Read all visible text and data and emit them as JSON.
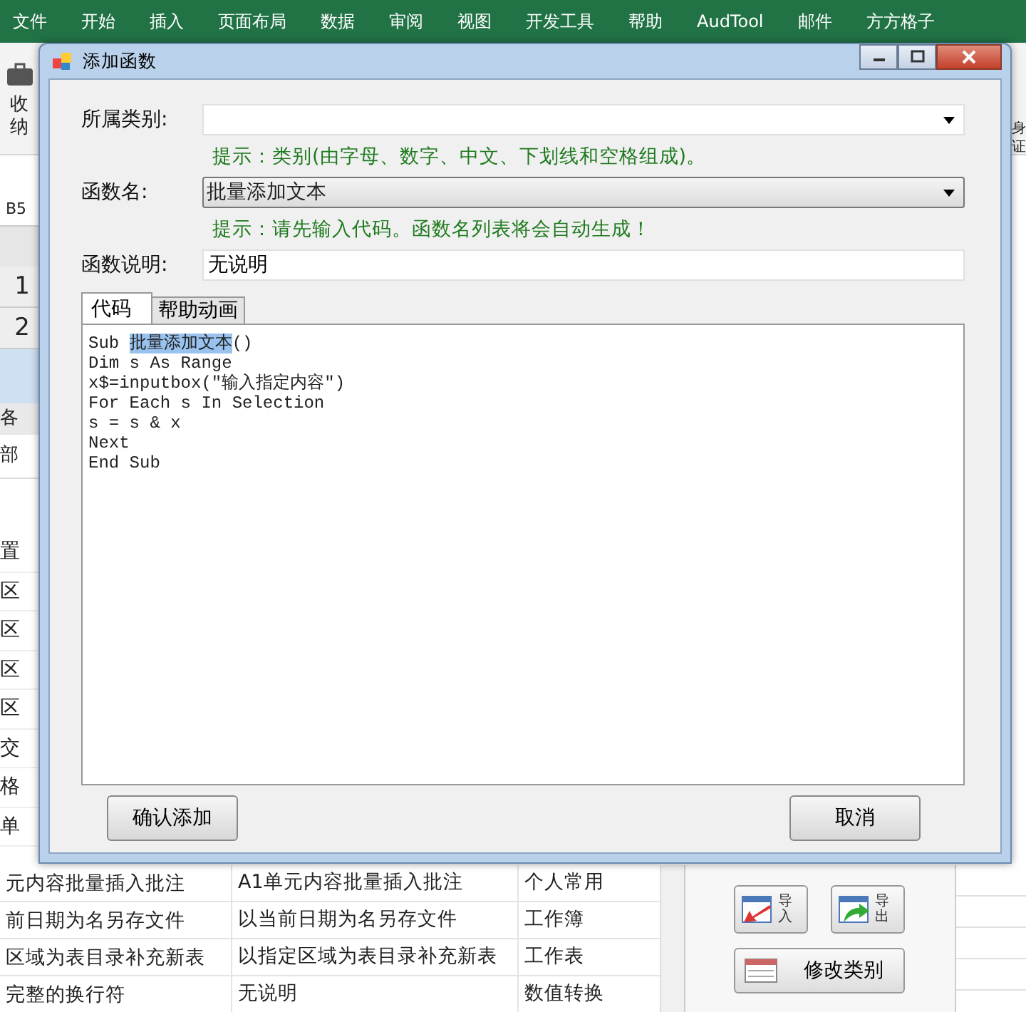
{
  "ribbon_tabs": [
    "文件",
    "开始",
    "插入",
    "页面布局",
    "数据",
    "审阅",
    "视图",
    "开发工具",
    "帮助",
    "AudTool",
    "邮件",
    "方方格子"
  ],
  "ribbon_left_labels": [
    "收",
    "纳"
  ],
  "ribbon_right_labels": [
    "身",
    "证"
  ],
  "name_box": "B5",
  "row_headers": [
    "1",
    "2"
  ],
  "side_list": {
    "header": "各",
    "first": "部",
    "items": [
      "置",
      "区",
      "区",
      "区",
      "区",
      "交",
      "格",
      "单"
    ]
  },
  "dialog": {
    "title": "添加函数",
    "category": {
      "label": "所属类别:",
      "hint": "提示：类别(由字母、数字、中文、下划线和空格组成)。"
    },
    "function_name": {
      "label": "函数名:",
      "value": "批量添加文本",
      "hint": "提示：请先输入代码。函数名列表将会自动生成！"
    },
    "description": {
      "label": "函数说明:",
      "value": "无说明"
    },
    "tabs": [
      {
        "label": "代码",
        "selected": true
      },
      {
        "label": "帮助动画",
        "selected": false
      }
    ],
    "code_lines": [
      {
        "segments": [
          {
            "text": "Sub ",
            "selected": false
          },
          {
            "text": "批量添加文本",
            "selected": true
          },
          {
            "text": "()",
            "selected": false
          }
        ]
      },
      {
        "segments": [
          {
            "text": "Dim s As Range",
            "selected": false
          }
        ]
      },
      {
        "segments": [
          {
            "text": "x$=inputbox(\"输入指定内容\")",
            "selected": false
          }
        ]
      },
      {
        "segments": [
          {
            "text": "For Each s In Selection",
            "selected": false
          }
        ]
      },
      {
        "segments": [
          {
            "text": "s = s & x",
            "selected": false
          }
        ]
      },
      {
        "segments": [
          {
            "text": "Next",
            "selected": false
          }
        ]
      },
      {
        "segments": [
          {
            "text": "End Sub",
            "selected": false
          }
        ]
      }
    ],
    "buttons": [
      "确认添加",
      "取消"
    ]
  },
  "table_rows": [
    {
      "cells": [
        "元内容批量插入批注",
        "A1单元内容批量插入批注",
        "个人常用"
      ]
    },
    {
      "cells": [
        "前日期为名另存文件",
        "以当前日期为名另存文件",
        "工作簿"
      ]
    },
    {
      "cells": [
        "区域为表目录补充新表",
        "以指定区域为表目录补充新表",
        "工作表"
      ]
    },
    {
      "cells": [
        "完整的换行符",
        "无说明",
        "数值转换"
      ]
    }
  ],
  "side_buttons": [
    {
      "label": "导入",
      "kind": "import"
    },
    {
      "label": "导出",
      "kind": "export"
    },
    {
      "label": "修改类别",
      "kind": "wide"
    }
  ]
}
